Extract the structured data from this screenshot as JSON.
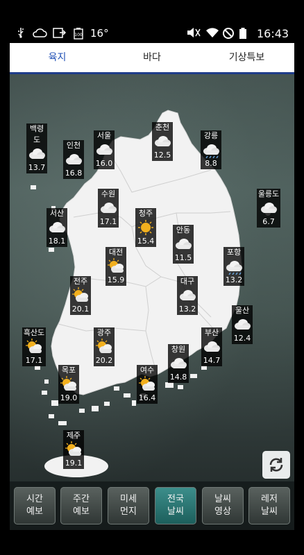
{
  "status_bar": {
    "temperature": "16°",
    "time": "16:43",
    "battery": "100"
  },
  "tabs": [
    {
      "label": "육지",
      "active": true
    },
    {
      "label": "바다",
      "active": false
    },
    {
      "label": "기상특보",
      "active": false
    }
  ],
  "cities": [
    {
      "name": "백령도",
      "temp": "13.7",
      "weather": "cloudy"
    },
    {
      "name": "인천",
      "temp": "16.8",
      "weather": "cloudy"
    },
    {
      "name": "서울",
      "temp": "16.0",
      "weather": "cloudy"
    },
    {
      "name": "춘천",
      "temp": "12.5",
      "weather": "cloudy"
    },
    {
      "name": "강릉",
      "temp": "8.8",
      "weather": "rain"
    },
    {
      "name": "울릉도",
      "temp": "6.7",
      "weather": "cloudy"
    },
    {
      "name": "서산",
      "temp": "18.1",
      "weather": "cloudy"
    },
    {
      "name": "수원",
      "temp": "17.1",
      "weather": "cloudy"
    },
    {
      "name": "청주",
      "temp": "15.4",
      "weather": "sunny"
    },
    {
      "name": "안동",
      "temp": "11.5",
      "weather": "cloudy"
    },
    {
      "name": "포항",
      "temp": "13.2",
      "weather": "rain"
    },
    {
      "name": "대전",
      "temp": "15.9",
      "weather": "partly-cloudy"
    },
    {
      "name": "전주",
      "temp": "20.1",
      "weather": "partly-cloudy"
    },
    {
      "name": "대구",
      "temp": "13.2",
      "weather": "cloudy"
    },
    {
      "name": "울산",
      "temp": "12.4",
      "weather": "cloudy"
    },
    {
      "name": "흑산도",
      "temp": "17.1",
      "weather": "partly-cloudy"
    },
    {
      "name": "광주",
      "temp": "20.2",
      "weather": "partly-cloudy"
    },
    {
      "name": "부산",
      "temp": "14.7",
      "weather": "cloudy"
    },
    {
      "name": "창원",
      "temp": "14.8",
      "weather": "cloudy"
    },
    {
      "name": "목포",
      "temp": "19.0",
      "weather": "partly-cloudy"
    },
    {
      "name": "여수",
      "temp": "16.4",
      "weather": "partly-cloudy"
    },
    {
      "name": "제주",
      "temp": "19.1",
      "weather": "partly-cloudy"
    }
  ],
  "bottom_nav": [
    {
      "line1": "시간",
      "line2": "예보",
      "active": false
    },
    {
      "line1": "주간",
      "line2": "예보",
      "active": false
    },
    {
      "line1": "미세",
      "line2": "먼지",
      "active": false
    },
    {
      "line1": "전국",
      "line2": "날씨",
      "active": true
    },
    {
      "line1": "날씨",
      "line2": "영상",
      "active": false
    },
    {
      "line1": "레저",
      "line2": "날씨",
      "active": false
    }
  ],
  "colors": {
    "tab_active": "#1f4fb5",
    "tab_underline": "#1f3d8a",
    "nav_active": "#2f7f7c",
    "sun": "#f2b01e"
  }
}
